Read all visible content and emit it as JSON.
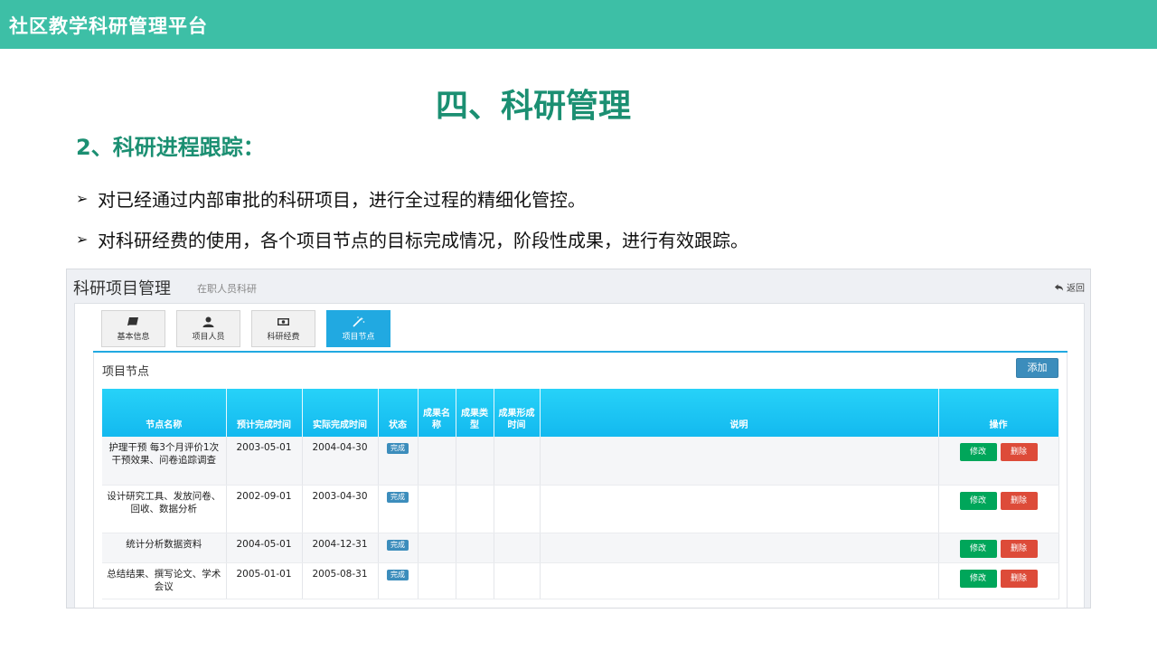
{
  "app": {
    "title": "社区教学科研管理平台"
  },
  "slide": {
    "title": "四、科研管理",
    "subtitle": "2、科研进程跟踪：",
    "bullets": [
      "对已经通过内部审批的科研项目，进行全过程的精细化管控。",
      "对科研经费的使用，各个项目节点的目标完成情况，阶段性成果，进行有效跟踪。"
    ]
  },
  "panel": {
    "title": "科研项目管理",
    "subtitle": "在职人员科研",
    "back_label": "返回",
    "tabs": [
      {
        "label": "基本信息",
        "icon": "book-icon"
      },
      {
        "label": "项目人员",
        "icon": "user-icon"
      },
      {
        "label": "科研经费",
        "icon": "money-icon"
      },
      {
        "label": "项目节点",
        "icon": "magic-wand-icon",
        "active": true
      }
    ],
    "section_title": "项目节点",
    "add_label": "添加",
    "table": {
      "headers": [
        "节点名称",
        "预计完成时间",
        "实际完成时间",
        "状态",
        "成果名称",
        "成果类型",
        "成果形成时间",
        "说明",
        "操作"
      ],
      "rows": [
        {
          "name": "护理干预 每3个月评价1次干预效果、问卷追踪调查",
          "planned": "2003-05-01",
          "actual": "2004-04-30",
          "status": "完成"
        },
        {
          "name": "设计研究工具、发放问卷、回收、数据分析",
          "planned": "2002-09-01",
          "actual": "2003-04-30",
          "status": "完成"
        },
        {
          "name": "统计分析数据资料",
          "planned": "2004-05-01",
          "actual": "2004-12-31",
          "status": "完成"
        },
        {
          "name": "总结结果、撰写论文、学术会议",
          "planned": "2005-01-01",
          "actual": "2005-08-31",
          "status": "完成"
        }
      ],
      "edit_label": "修改",
      "delete_label": "删除"
    }
  },
  "colors": {
    "topbar": "#3dbfa6",
    "heading": "#1b8f72",
    "accent": "#21a9e1",
    "edit": "#00a65a",
    "delete": "#dd4b39"
  }
}
